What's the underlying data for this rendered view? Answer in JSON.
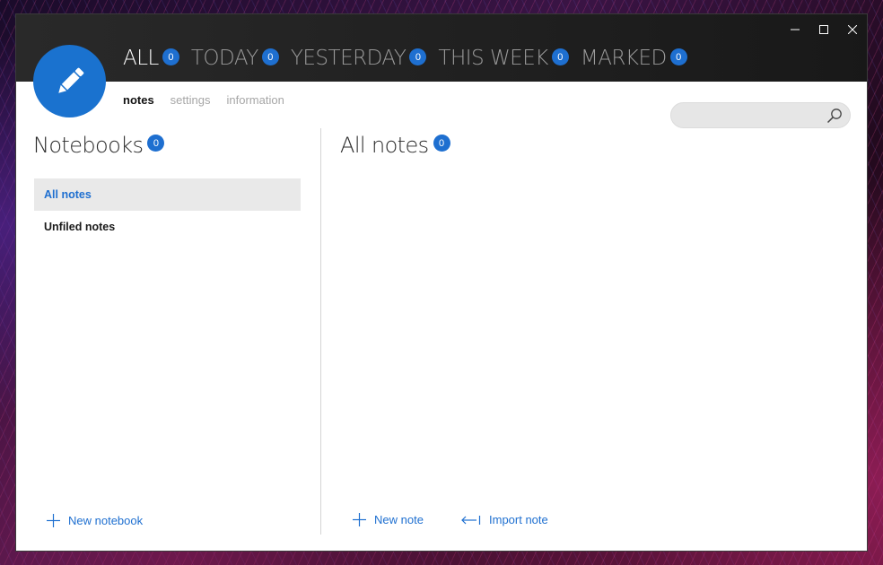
{
  "filters": [
    {
      "label": "ALL",
      "count": "0"
    },
    {
      "label": "TODAY",
      "count": "0"
    },
    {
      "label": "YESTERDAY",
      "count": "0"
    },
    {
      "label": "THIS WEEK",
      "count": "0"
    },
    {
      "label": "MARKED",
      "count": "0"
    }
  ],
  "subnav": {
    "notes": "notes",
    "settings": "settings",
    "information": "information"
  },
  "search": {
    "placeholder": "",
    "value": ""
  },
  "notebooks": {
    "title": "Notebooks",
    "count": "0",
    "items": [
      {
        "label": "All notes"
      },
      {
        "label": "Unfiled notes"
      }
    ],
    "new_label": "New notebook"
  },
  "notes": {
    "title": "All notes",
    "count": "0",
    "new_label": "New note",
    "import_label": "Import note"
  },
  "icons": {
    "logo": "pencil-icon",
    "search": "search-icon",
    "minimize": "minimize-icon",
    "maximize": "maximize-icon",
    "close": "close-icon",
    "add": "plus-icon",
    "import": "import-arrow-icon"
  },
  "colors": {
    "accent": "#1e6fd0",
    "logo": "#1a72cf",
    "titlebar": "#1a1a1a"
  }
}
